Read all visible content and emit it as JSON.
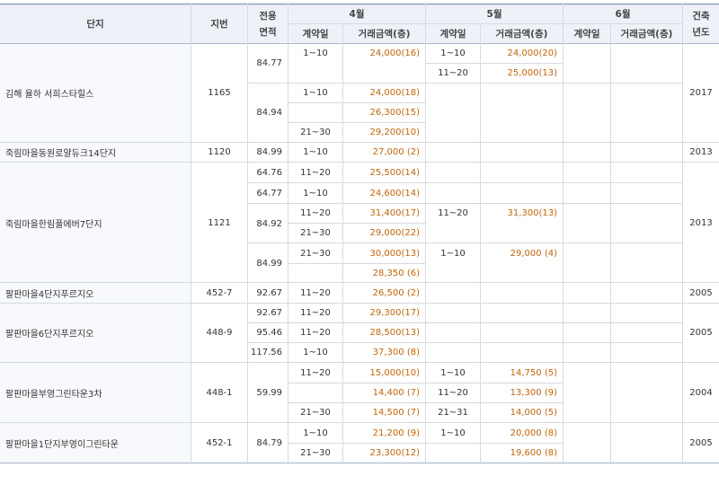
{
  "headers": {
    "complex": "단지",
    "lot": "지번",
    "area_line1": "전용",
    "area_line2": "면적",
    "month1": "4월",
    "month2": "5월",
    "month3": "6월",
    "built_line1": "건축",
    "built_line2": "년도",
    "contract_date": "계약일",
    "amount_count": "거래금액(층)"
  },
  "complexes": [
    {
      "name": "김해 율하 서희스타힐스",
      "lot": "1165",
      "year": "2017"
    },
    {
      "name": "죽림마을동원로얄듀크14단지",
      "lot": "1120",
      "year": "2013"
    },
    {
      "name": "죽림마을한림풀에버7단지",
      "lot": "1121",
      "year": "2013"
    },
    {
      "name": "팔판마을4단지푸르지오",
      "lot": "452-7",
      "year": "2005"
    },
    {
      "name": "팔판마을6단지푸르지오",
      "lot": "448-9",
      "year": "2005"
    },
    {
      "name": "팔판마을부영그린타운3차",
      "lot": "448-1",
      "year": "2004"
    },
    {
      "name": "팔판마을1단지부영이그린타운",
      "lot": "452-1",
      "year": "2005"
    }
  ],
  "areas": [
    "84.77",
    "84.94",
    "84.99",
    "64.76",
    "64.77",
    "84.92",
    "84.99",
    "92.67",
    "92.67",
    "95.46",
    "117.56",
    "59.99",
    "84.79"
  ],
  "rows": [
    {
      "apr_date": "1~10",
      "apr_amt": "24,000(16)",
      "may_date": "1~10",
      "may_amt": "24,000(20)"
    },
    {
      "apr_date": "",
      "apr_amt": "",
      "may_date": "11~20",
      "may_amt": "25,000(13)"
    },
    {
      "apr_date": "1~10",
      "apr_amt": "24,000(18)",
      "may_date": "",
      "may_amt": ""
    },
    {
      "apr_date": "",
      "apr_amt": "26,300(15)",
      "may_date": "",
      "may_amt": ""
    },
    {
      "apr_date": "21~30",
      "apr_amt": "29,200(10)",
      "may_date": "",
      "may_amt": ""
    },
    {
      "apr_date": "1~10",
      "apr_amt": "27,000 (2)",
      "may_date": "",
      "may_amt": ""
    },
    {
      "apr_date": "11~20",
      "apr_amt": "25,500(14)",
      "may_date": "",
      "may_amt": ""
    },
    {
      "apr_date": "1~10",
      "apr_amt": "24,600(14)",
      "may_date": "",
      "may_amt": ""
    },
    {
      "apr_date": "11~20",
      "apr_amt": "31,400(17)",
      "may_date": "11~20",
      "may_amt": "31,300(13)"
    },
    {
      "apr_date": "21~30",
      "apr_amt": "29,000(22)",
      "may_date": "",
      "may_amt": ""
    },
    {
      "apr_date": "21~30",
      "apr_amt": "30,000(13)",
      "may_date": "1~10",
      "may_amt": "29,000 (4)"
    },
    {
      "apr_date": "",
      "apr_amt": "28,350 (6)",
      "may_date": "",
      "may_amt": ""
    },
    {
      "apr_date": "11~20",
      "apr_amt": "26,500 (2)",
      "may_date": "",
      "may_amt": ""
    },
    {
      "apr_date": "11~20",
      "apr_amt": "29,300(17)",
      "may_date": "",
      "may_amt": ""
    },
    {
      "apr_date": "11~20",
      "apr_amt": "28,500(13)",
      "may_date": "",
      "may_amt": ""
    },
    {
      "apr_date": "1~10",
      "apr_amt": "37,300 (8)",
      "may_date": "",
      "may_amt": ""
    },
    {
      "apr_date": "11~20",
      "apr_amt": "15,000(10)",
      "may_date": "1~10",
      "may_amt": "14,750 (5)"
    },
    {
      "apr_date": "",
      "apr_amt": "14,400 (7)",
      "may_date": "11~20",
      "may_amt": "13,300 (9)"
    },
    {
      "apr_date": "21~30",
      "apr_amt": "14,500 (7)",
      "may_date": "21~31",
      "may_amt": "14,000 (5)"
    },
    {
      "apr_date": "1~10",
      "apr_amt": "21,200 (9)",
      "may_date": "1~10",
      "may_amt": "20,000 (8)"
    },
    {
      "apr_date": "21~30",
      "apr_amt": "23,300(12)",
      "may_date": "",
      "may_amt": "19,600 (8)"
    }
  ],
  "colors": {
    "header_bg": "#eef2f8",
    "grid_line": "#d4dae2",
    "name_bg": "#f7f9fc",
    "amount_text": "#c0640a"
  }
}
